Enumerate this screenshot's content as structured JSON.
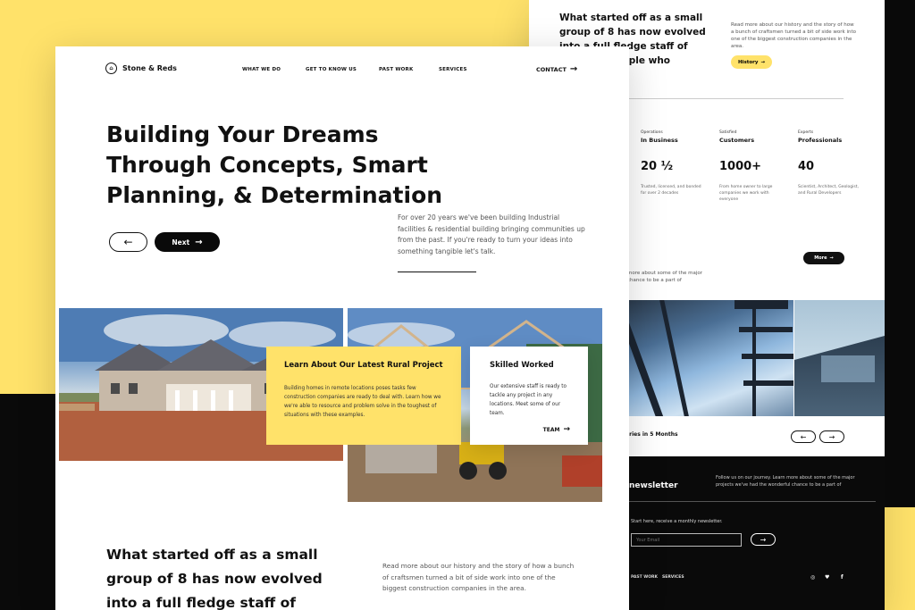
{
  "brand": {
    "name": "Stone & Reds",
    "logo_glyph": "⌂"
  },
  "nav": {
    "links": [
      "WHAT WE DO",
      "GET TO KNOW US",
      "PAST WORK",
      "SERVICES"
    ],
    "contact": "CONTACT",
    "arrow": "→"
  },
  "hero": {
    "title": "Building Your Dreams Through Concepts, Smart Planning, & Determination",
    "back_arrow": "←",
    "next_label": "Next",
    "next_arrow": "→",
    "paragraph": "For over 20 years we've been building Industrial facilities & residential building bringing communities up from the past. If you're ready to turn your ideas into something tangible let's talk."
  },
  "cards": {
    "rural": {
      "title": "Learn About Our Latest Rural Project",
      "text": "Building homes in remote locations poses tasks few construction companies are ready to deal with.  Learn how we we're able to resource and problem solve in the toughest of situations with these examples."
    },
    "skilled": {
      "title": "Skilled Worked",
      "text": "Our extensive staff is ready to tackle any project in any locations. Meet some of our team.",
      "link": "TEAM",
      "arrow": "→"
    }
  },
  "about": {
    "heading": "What started off as a small group of 8 has now evolved into a full fledge staff of devoted and",
    "paragraph": "Read more about our history and the story of how a bunch of craftsmen turned a bit of side work into one of the biggest construction companies in the area."
  },
  "back_page": {
    "heading": "What started off as a small group of 8 has now evolved into a full fledge staff of devoted and ple who modernize",
    "paragraph": "Read more about our history and the story of how a bunch of craftsmen turned a bit of side work into one of the biggest construction companies in the area.",
    "history_button": "History",
    "stats": [
      {
        "label": "Operations",
        "title": "In Business",
        "number": "20 ½",
        "desc": "Trusted, licensed, and bonded for over 2 decades"
      },
      {
        "label": "Satisfied",
        "title": "Customers",
        "number": "1000+",
        "desc": "From home owner to large companies we work with everyone"
      },
      {
        "label": "Experts",
        "title": "Professionals",
        "number": "40",
        "desc": "Scientist, Architect, Geologist, and Rural Developers"
      }
    ],
    "more_button": "More",
    "more_text": "more about some of the  major chance to be a part of",
    "stories_label": "ories in 5 Months",
    "prev_arrow": "←",
    "next_arrow": "→",
    "newsletter": {
      "title": "newsletter",
      "text": "Follow us on our journey. Learn more about some of the  major projects we've had the wonderful chance to be a part of",
      "start": "Start here, receive a monthly newsletter.",
      "input_placeholder": "Your Email",
      "submit_arrow": "→",
      "footer_links": [
        "PAST WORK",
        "SERVICES"
      ],
      "social_icons": [
        "◎",
        "♥",
        "f"
      ]
    }
  }
}
